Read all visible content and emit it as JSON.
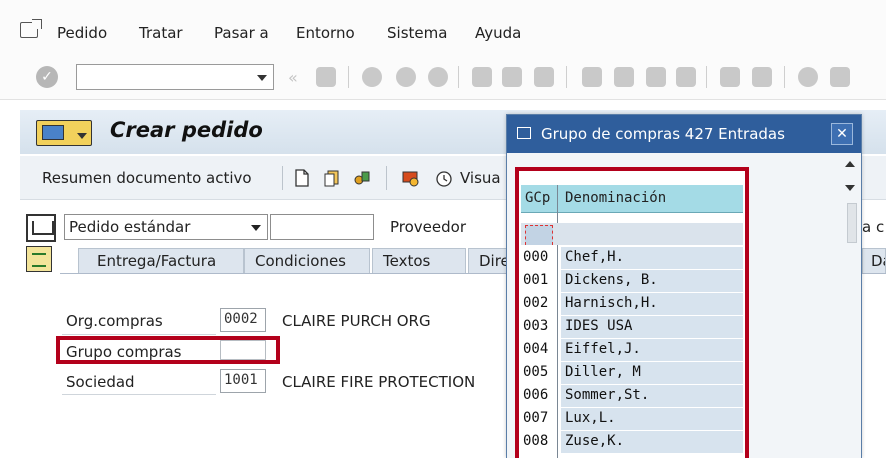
{
  "menu": {
    "items": [
      "Pedido",
      "Tratar",
      "Pasar a",
      "Entorno",
      "Sistema",
      "Ayuda"
    ]
  },
  "toolbar": {
    "command_field_value": ""
  },
  "header": {
    "title": "Crear pedido"
  },
  "app_toolbar": {
    "resumen_label": "Resumen documento activo",
    "visual_label": "Visua"
  },
  "doc_header": {
    "doc_type_value": "Pedido estándar",
    "doc_number_value": "",
    "vendor_label": "Proveedor",
    "right_partial_label": "a c"
  },
  "tabs": [
    "Entrega/Factura",
    "Condiciones",
    "Textos",
    "Dire",
    "Da"
  ],
  "fields": {
    "org_label": "Org.compras",
    "org_value": "0002",
    "org_desc": "CLAIRE PURCH ORG",
    "grupo_label": "Grupo compras",
    "grupo_value": "",
    "sociedad_label": "Sociedad",
    "sociedad_value": "1001",
    "sociedad_desc": "CLAIRE FIRE PROTECTION"
  },
  "popup": {
    "title": "Grupo de compras 427 Entradas",
    "close_label": "✕",
    "columns": [
      "GCp",
      "Denominación"
    ],
    "rows": [
      {
        "code": "000",
        "name": "Chef,H."
      },
      {
        "code": "001",
        "name": "Dickens, B."
      },
      {
        "code": "002",
        "name": "Harnisch,H."
      },
      {
        "code": "003",
        "name": "IDES USA"
      },
      {
        "code": "004",
        "name": "Eiffel,J."
      },
      {
        "code": "005",
        "name": "Diller, M"
      },
      {
        "code": "006",
        "name": "Sommer,St."
      },
      {
        "code": "007",
        "name": "Lux,L."
      },
      {
        "code": "008",
        "name": "Zuse,K."
      }
    ]
  },
  "colors": {
    "popup_title_bg": "#2f5e9c",
    "highlight_red": "#b3001b",
    "header_cyan": "#a4dbe6"
  }
}
